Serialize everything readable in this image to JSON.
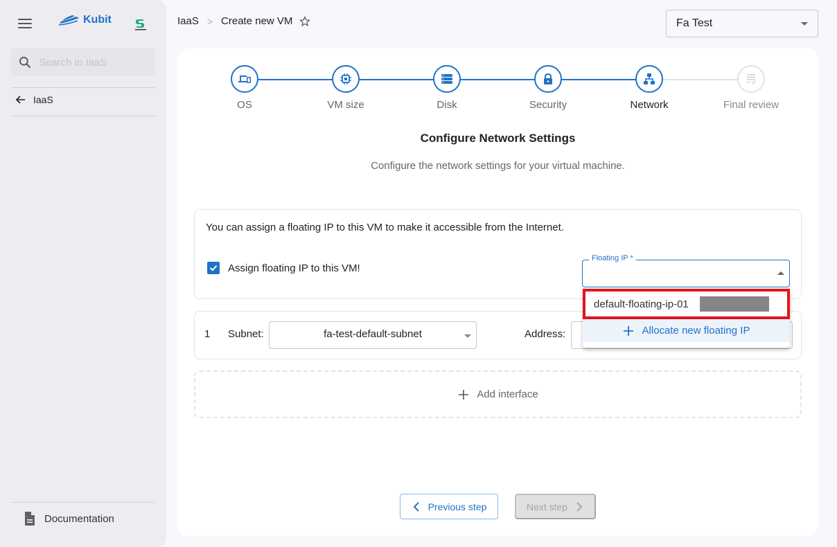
{
  "sidebar": {
    "brand": "Kubit",
    "search_placeholder": "Search in IaaS",
    "back_label": "IaaS",
    "documentation_label": "Documentation"
  },
  "header": {
    "breadcrumb": [
      "IaaS",
      "Create new VM"
    ],
    "project_selected": "Fa Test"
  },
  "stepper": {
    "steps": [
      {
        "label": "OS",
        "icon": "laptop-phone-icon",
        "state": "completed"
      },
      {
        "label": "VM size",
        "icon": "chip-icon",
        "state": "completed"
      },
      {
        "label": "Disk",
        "icon": "storage-icon",
        "state": "completed"
      },
      {
        "label": "Security",
        "icon": "lock-icon",
        "state": "completed"
      },
      {
        "label": "Network",
        "icon": "network-icon",
        "state": "active"
      },
      {
        "label": "Final review",
        "icon": "checklist-icon",
        "state": "pending"
      }
    ]
  },
  "content": {
    "title": "Configure Network Settings",
    "subtitle": "Configure the network settings for your virtual machine."
  },
  "floating_ip": {
    "description": "You can assign a floating IP to this VM to make it accessible from the Internet.",
    "checkbox_label": "Assign floating IP to this VM!",
    "checkbox_checked": true,
    "field_label": "Floating IP *",
    "field_value": "",
    "options": [
      {
        "name": "default-floating-ip-01",
        "address_redacted": true
      }
    ],
    "allocate_label": "Allocate new floating IP"
  },
  "interfaces": [
    {
      "index": "1",
      "subnet_label": "Subnet:",
      "subnet_value": "fa-test-default-subnet",
      "address_label": "Address:"
    }
  ],
  "add_interface_label": "Add interface",
  "buttons": {
    "previous": "Previous step",
    "next": "Next step",
    "next_disabled": true
  },
  "colors": {
    "accent": "#1f72c9",
    "highlight_border": "#e0141e",
    "sidebar_bg": "#ededf1"
  }
}
